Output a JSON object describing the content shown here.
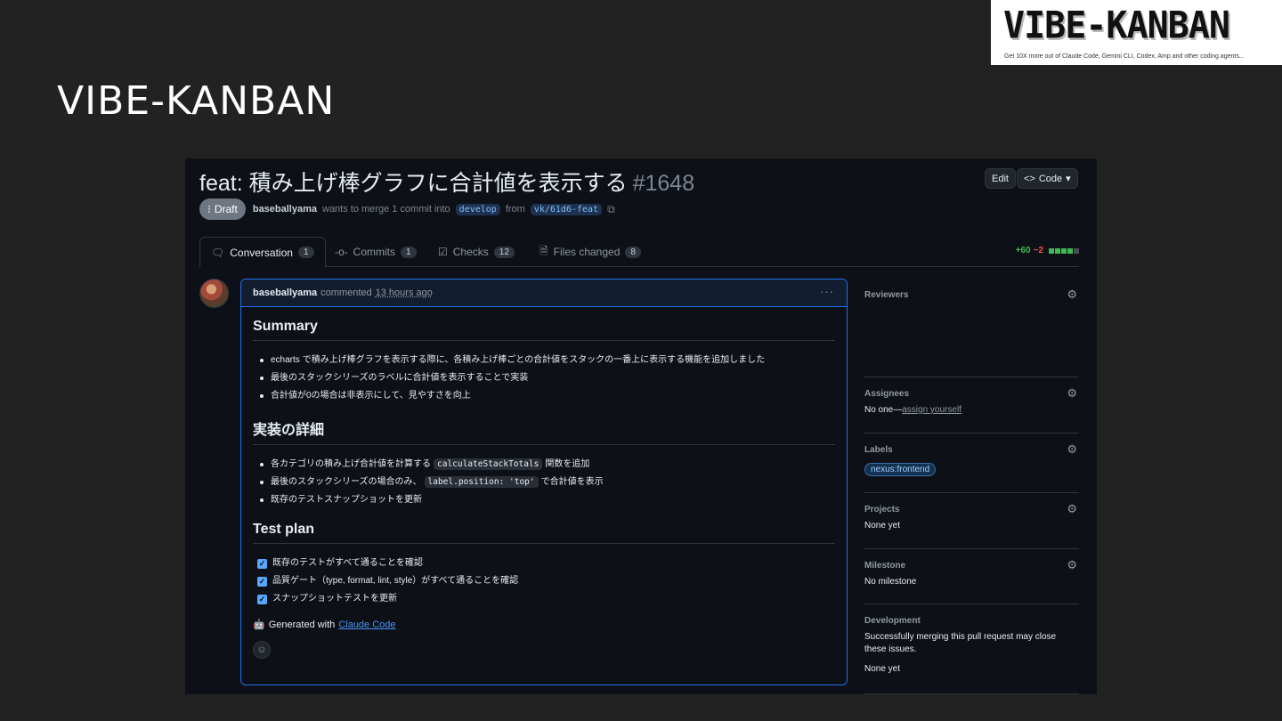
{
  "slide": {
    "title": "VIBE-KANBAN",
    "logo_word": "VIBE-KANBAN",
    "logo_tagline": "Get 10X more out of Claude Code, Gemini CLI, Codex, Amp and other coding agents..."
  },
  "pr": {
    "title": "feat: 積み上げ棒グラフに合計値を表示する",
    "number": "#1648",
    "edit_label": "Edit",
    "code_label": "Code",
    "draft_label": "Draft",
    "author": "baseballyama",
    "merge_text": "wants to merge 1 commit into",
    "base_branch": "develop",
    "from_text": "from",
    "head_branch": "vk/61d6-feat"
  },
  "tabs": [
    {
      "label": "Conversation",
      "count": "1",
      "icon": "comment-discussion-icon"
    },
    {
      "label": "Commits",
      "count": "1",
      "icon": "git-commit-icon"
    },
    {
      "label": "Checks",
      "count": "12",
      "icon": "checklist-icon"
    },
    {
      "label": "Files changed",
      "count": "8",
      "icon": "file-diff-icon"
    }
  ],
  "diffstat": {
    "additions": "+60",
    "deletions": "−2",
    "colors": {
      "add": "#3fb950",
      "del": "#f85149"
    }
  },
  "comment": {
    "author": "baseballyama",
    "action": "commented",
    "timestamp": "13 hours ago",
    "summary_heading": "Summary",
    "summary_items": [
      "echarts で積み上げ棒グラフを表示する際に、各積み上げ棒ごとの合計値をスタックの一番上に表示する機能を追加しました",
      "最後のスタックシリーズのラベルに合計値を表示することで実装",
      "合計値が0の場合は非表示にして、見やすさを向上"
    ],
    "details_heading": "実装の詳細",
    "details": {
      "item1_pre": "各カテゴリの積み上げ合計値を計算する",
      "item1_code": "calculateStackTotals",
      "item1_post": "関数を追加",
      "item2_pre": "最後のスタックシリーズの場合のみ、",
      "item2_code": "label.position: 'top'",
      "item2_post": "で合計値を表示",
      "item3": "既存のテストスナップショットを更新"
    },
    "testplan_heading": "Test plan",
    "testplan_items": [
      "既存のテストがすべて通ることを確認",
      "品質ゲート（type, format, lint, style）がすべて通ることを確認",
      "スナップショットテストを更新"
    ],
    "generated_prefix": "Generated with",
    "generated_link": "Claude Code"
  },
  "sidebar": {
    "reviewers_heading": "Reviewers",
    "assignees_heading": "Assignees",
    "assignees_none": "No one—",
    "assign_yourself": "assign yourself",
    "labels_heading": "Labels",
    "label_value": "nexus:frontend",
    "projects_heading": "Projects",
    "projects_value": "None yet",
    "milestone_heading": "Milestone",
    "milestone_value": "No milestone",
    "development_heading": "Development",
    "development_text": "Successfully merging this pull request may close these issues.",
    "development_value": "None yet"
  }
}
